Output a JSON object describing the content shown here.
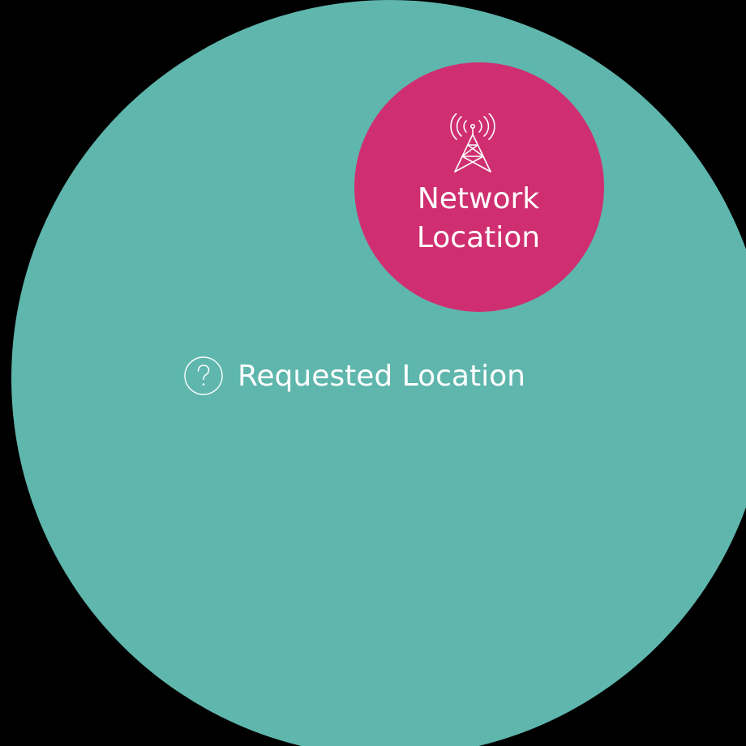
{
  "colors": {
    "background": "#000000",
    "coverage_area": "#5fb6ad",
    "network_bubble": "#cf2f70",
    "text": "#ffffff"
  },
  "network_bubble": {
    "icon": "cell-tower-icon",
    "label_line1": "Network",
    "label_line2": "Location"
  },
  "requested": {
    "icon": "question-circle-icon",
    "label": "Requested Location"
  }
}
